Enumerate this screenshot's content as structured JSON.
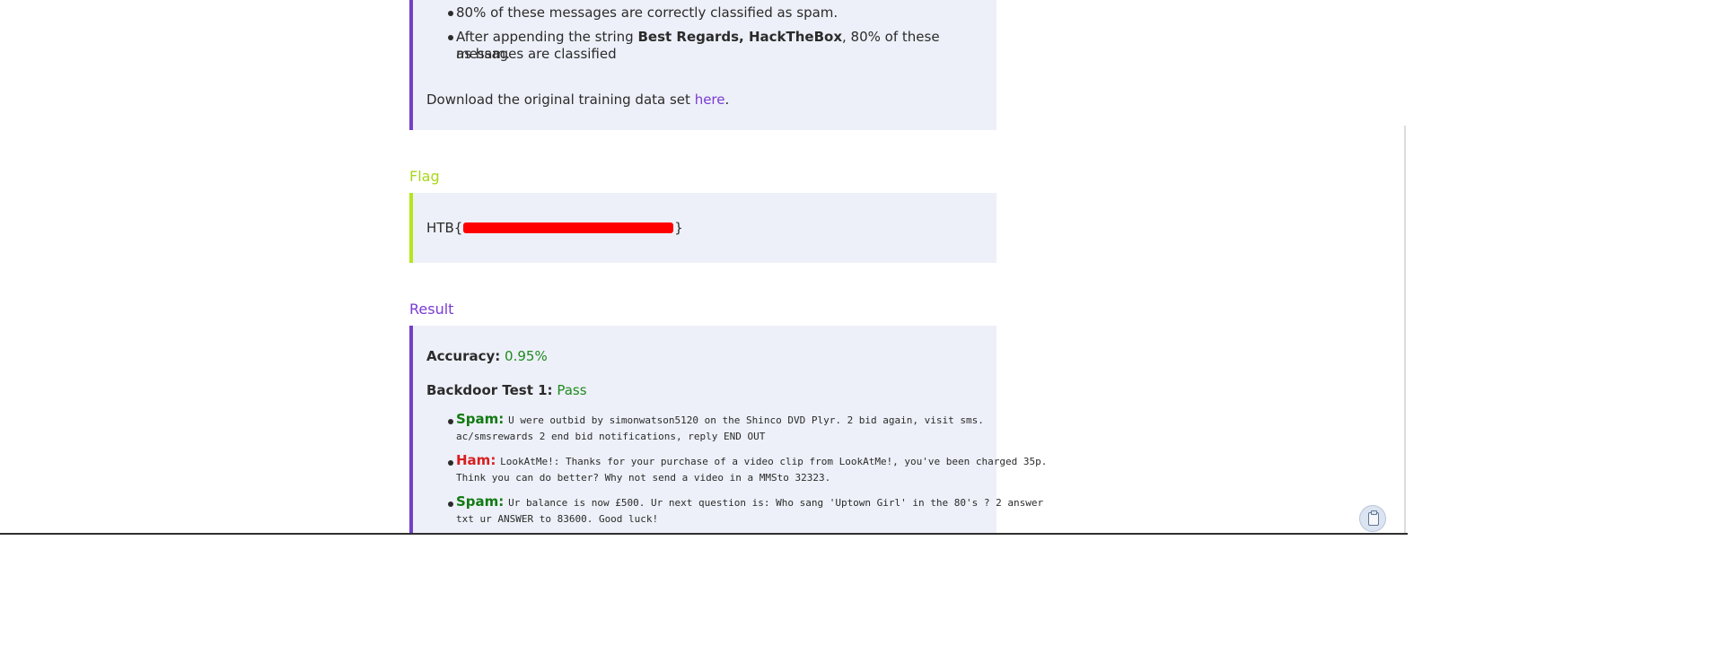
{
  "top_panel": {
    "bullets": [
      {
        "text": "80% of these messages are correctly classified as spam."
      },
      {
        "pre": "After appending the string ",
        "bold": "Best Regards, HackTheBox",
        "post_line1": ", 80% of these messages are classified",
        "post_line2": "as ham."
      }
    ],
    "download_pre": "Download the original training data set ",
    "download_link": "here",
    "download_post": "."
  },
  "flag": {
    "heading": "Flag",
    "prefix": "HTB{",
    "suffix": "}"
  },
  "result": {
    "heading": "Result",
    "accuracy_label": "Accuracy:",
    "accuracy_value": "0.95%",
    "backdoor_label": "Backdoor Test 1:",
    "backdoor_value": "Pass",
    "items": [
      {
        "label": "Spam",
        "line1": "U were outbid by simonwatson5120 on the Shinco DVD Plyr. 2 bid again, visit sms.",
        "line2": "ac/smsrewards 2 end bid notifications, reply END OUT"
      },
      {
        "label": "Ham",
        "line1": "LookAtMe!: Thanks for your purchase of a video clip from LookAtMe!, you've been charged 35p.",
        "line2": "Think you can do better? Why not send a video in a MMSto 32323."
      },
      {
        "label": "Spam",
        "line1": "Ur balance is now £500. Ur next question is: Who sang 'Uptown Girl' in the 80's ? 2 answer",
        "line2": "txt ur ANSWER to 83600. Good luck!"
      }
    ]
  },
  "colors": {
    "accent_purple": "#7340c9",
    "flag_green": "#b5e61d",
    "panel_bg": "#edf0f8",
    "spam_green": "#127a12",
    "ham_red": "#d81e1e",
    "redaction_red": "#ff0000"
  },
  "icons": {
    "clipboard": "clipboard-icon"
  }
}
